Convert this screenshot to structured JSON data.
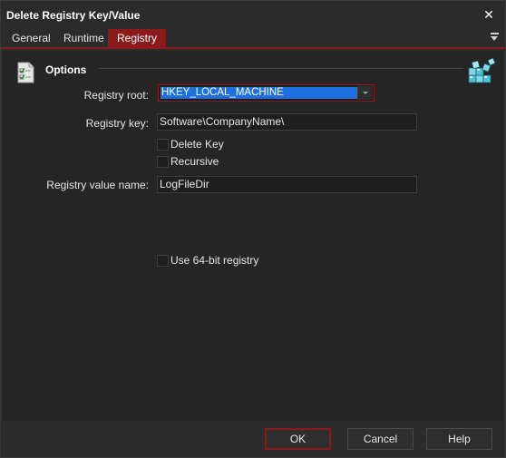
{
  "window": {
    "title": "Delete Registry Key/Value"
  },
  "tabs": [
    {
      "label": "General"
    },
    {
      "label": "Runtime"
    },
    {
      "label": "Registry"
    }
  ],
  "section": {
    "title": "Options"
  },
  "form": {
    "registry_root": {
      "label": "Registry root:",
      "value": "HKEY_LOCAL_MACHINE"
    },
    "registry_key": {
      "label": "Registry key:",
      "value": "Software\\CompanyName\\"
    },
    "delete_key": {
      "label": "Delete Key",
      "checked": false
    },
    "recursive": {
      "label": "Recursive",
      "checked": false
    },
    "registry_value_name": {
      "label": "Registry value name:",
      "value": "LogFileDir"
    },
    "use_64bit": {
      "label": "Use 64-bit registry",
      "checked": false
    }
  },
  "buttons": {
    "ok": "OK",
    "cancel": "Cancel",
    "help": "Help"
  },
  "icons": {
    "close": "close-icon",
    "tab_menu": "overflow-menu-icon",
    "options": "checklist-icon",
    "registry": "registry-cubes-icon"
  },
  "colors": {
    "accent": "#8b1a1a",
    "selection": "#1e6fe0",
    "background": "#2b2b2b",
    "panel": "#252525"
  }
}
